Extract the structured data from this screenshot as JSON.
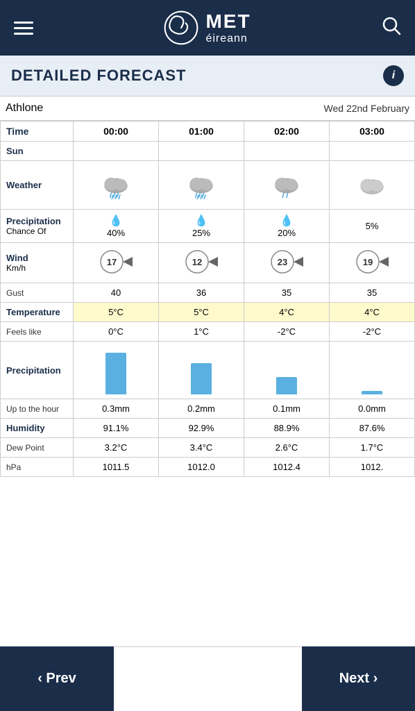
{
  "header": {
    "menu_label": "Menu",
    "logo_met": "MET",
    "logo_eireann": "éireann",
    "search_label": "Search"
  },
  "title_bar": {
    "title": "DETAILED FORECAST",
    "info_label": "i"
  },
  "location": {
    "name": "Athlone",
    "date": "Wed 22nd February"
  },
  "columns": {
    "times": [
      "00:00",
      "01:00",
      "02:00",
      "03:00"
    ],
    "sun": [
      "",
      "",
      "",
      ""
    ],
    "weather_icons": [
      "rain-heavy",
      "rain-medium",
      "rain-light",
      "cloudy"
    ],
    "precip_chance": [
      "40%",
      "25%",
      "20%",
      "5%"
    ],
    "wind_speed": [
      "17",
      "12",
      "23",
      "19"
    ],
    "gust": [
      "40",
      "36",
      "35",
      "35"
    ],
    "temperature": [
      "5°C",
      "5°C",
      "4°C",
      "4°C"
    ],
    "feels_like": [
      "0°C",
      "1°C",
      "-2°C",
      "-2°C"
    ],
    "precip_mm": [
      "0.3mm",
      "0.2mm",
      "0.1mm",
      "0.0mm"
    ],
    "precip_bar_heights": [
      60,
      45,
      25,
      5
    ],
    "humidity": [
      "91.1%",
      "92.9%",
      "88.9%",
      "87.6%"
    ],
    "dew_point": [
      "3.2°C",
      "3.4°C",
      "2.6°C",
      "1.7°C"
    ],
    "hpa": [
      "1011.5",
      "1012.0",
      "1012.4",
      "1012."
    ]
  },
  "rows": {
    "time_label": "Time",
    "sun_label": "Sun",
    "weather_label": "Weather",
    "precip_label": "Precipitation",
    "chance_of_label": "Chance Of",
    "wind_label": "Wind",
    "kmh_label": "Km/h",
    "gust_label": "Gust",
    "temperature_label": "Temperature",
    "feels_like_label": "Feels like",
    "precipitation_label": "Precipitation",
    "up_to_hour_label": "Up to the hour",
    "humidity_label": "Humidity",
    "dew_point_label": "Dew Point",
    "hpa_label": "hPa"
  },
  "nav": {
    "prev_label": "‹ Prev",
    "next_label": "Next ›"
  }
}
